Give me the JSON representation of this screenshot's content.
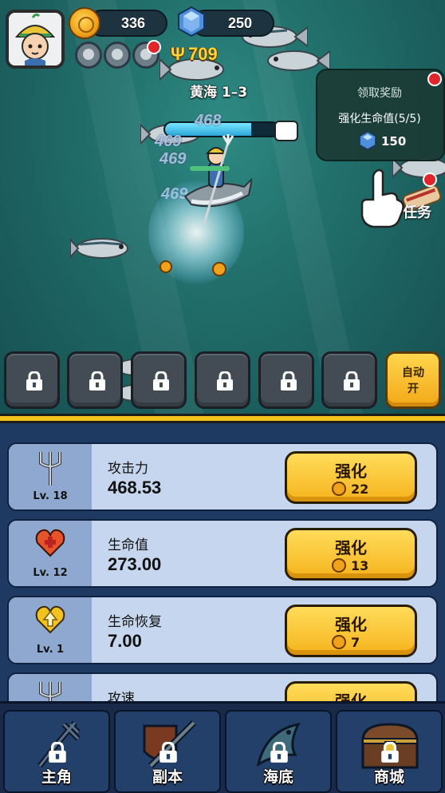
{
  "player": {
    "avatar_icon": "diver-avatar-icon"
  },
  "currency": {
    "coins": "336",
    "gems": "250"
  },
  "hud": {
    "power": "709",
    "stage": "黄海 1–3"
  },
  "quest": {
    "title": "领取奖励",
    "description": "强化生命值(5/5)",
    "reward_value": "150",
    "task_label": "任务"
  },
  "battle": {
    "damage_numbers": [
      "468",
      "469",
      "469",
      "469"
    ],
    "enemy_hp_fraction": 0.76
  },
  "skills": {
    "slots": [
      "locked",
      "locked",
      "locked",
      "locked",
      "locked",
      "locked"
    ],
    "auto_label_line1": "自动",
    "auto_label_line2": "开"
  },
  "upgrades": [
    {
      "icon": "trident-icon",
      "level": "Lv. 18",
      "name": "攻击力",
      "value": "468.53",
      "button": "强化",
      "cost": "22"
    },
    {
      "icon": "heart-icon",
      "level": "Lv. 12",
      "name": "生命值",
      "value": "273.00",
      "button": "强化",
      "cost": "13"
    },
    {
      "icon": "heart-up-icon",
      "level": "Lv. 1",
      "name": "生命恢复",
      "value": "7.00",
      "button": "强化",
      "cost": "7"
    },
    {
      "icon": "trident-speed-icon",
      "level": "",
      "name": "攻速",
      "value": "",
      "button": "强化",
      "cost": ""
    }
  ],
  "nav": [
    {
      "label": "主角",
      "icon": "trident-icon"
    },
    {
      "label": "副本",
      "icon": "sword-shield-icon"
    },
    {
      "label": "海底",
      "icon": "fish-icon"
    },
    {
      "label": "商城",
      "icon": "treasure-chest-icon"
    }
  ],
  "colors": {
    "accent_yellow": "#f6c21c",
    "panel_blue": "#1f3a62",
    "card_bg": "#c6d6ee"
  }
}
